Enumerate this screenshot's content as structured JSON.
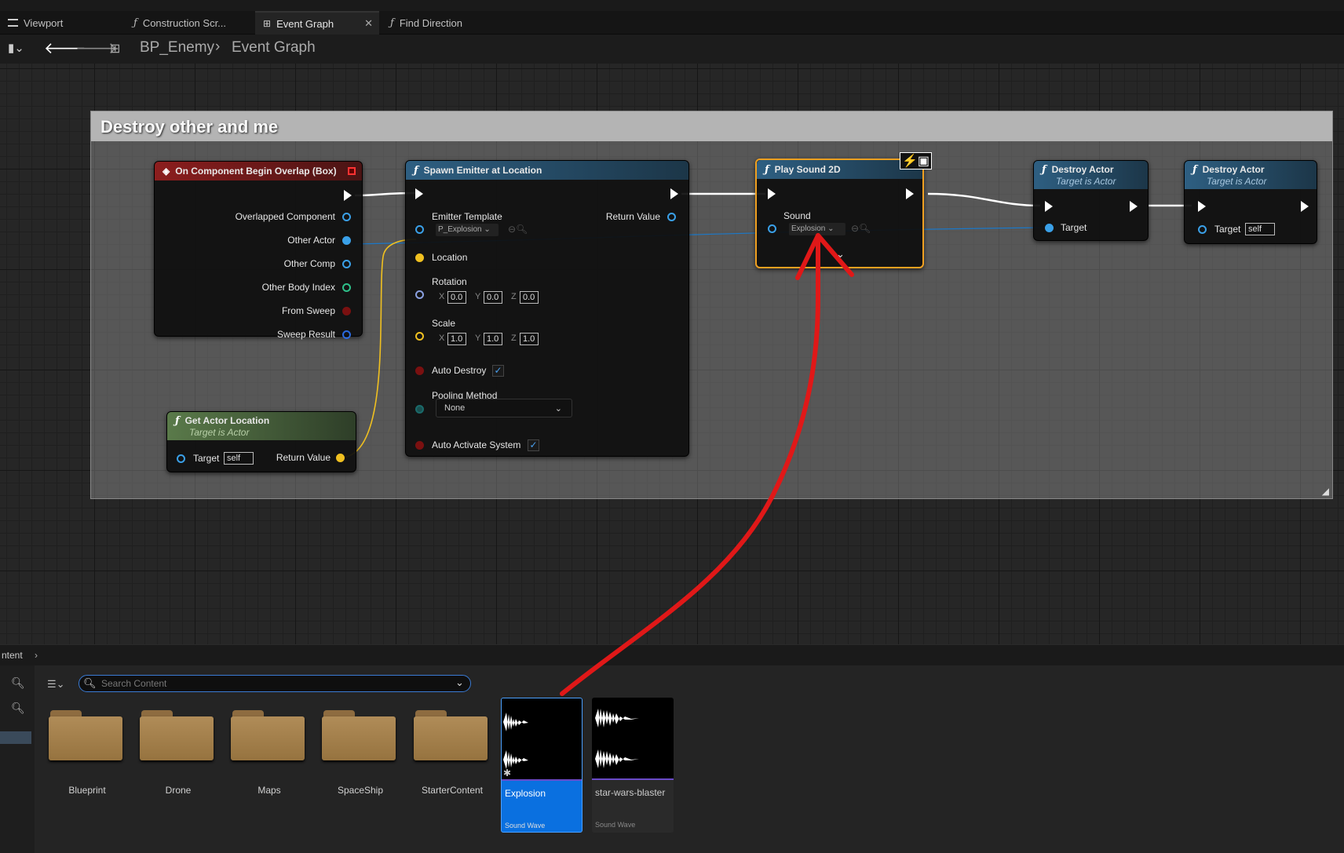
{
  "tabs": [
    {
      "label": "Viewport"
    },
    {
      "label": "Construction Scr..."
    },
    {
      "label": "Event Graph"
    },
    {
      "label": "Find Direction"
    }
  ],
  "breadcrumb": {
    "root": "BP_Enemy",
    "current": "Event Graph"
  },
  "comment": {
    "title": "Destroy other and me"
  },
  "nodes": {
    "overlap": {
      "title": "On Component Begin Overlap (Box)",
      "pins": [
        "Overlapped Component",
        "Other Actor",
        "Other Comp",
        "Other Body Index",
        "From Sweep",
        "Sweep Result"
      ]
    },
    "spawn": {
      "title": "Spawn Emitter at Location",
      "emitter_label": "Emitter Template",
      "emitter_value": "P_Explosion",
      "return_label": "Return Value",
      "location": "Location",
      "rotation": "Rotation",
      "scale": "Scale",
      "rot": {
        "x": "0.0",
        "y": "0.0",
        "z": "0.0"
      },
      "scl": {
        "x": "1.0",
        "y": "1.0",
        "z": "1.0"
      },
      "axis": {
        "x": "X",
        "y": "Y",
        "z": "Z"
      },
      "auto_destroy": "Auto Destroy",
      "pooling": "Pooling Method",
      "pooling_value": "None",
      "auto_activate": "Auto Activate System"
    },
    "getloc": {
      "title": "Get Actor Location",
      "subtitle": "Target is Actor",
      "target": "Target",
      "self": "self",
      "return_label": "Return Value"
    },
    "play": {
      "title": "Play Sound 2D",
      "sound": "Sound",
      "sound_value": "Explosion"
    },
    "destroy1": {
      "title": "Destroy Actor",
      "subtitle": "Target is Actor",
      "target": "Target"
    },
    "destroy2": {
      "title": "Destroy Actor",
      "subtitle": "Target is Actor",
      "target": "Target",
      "self": "self"
    }
  },
  "content_browser": {
    "breadcrumb": "ntent",
    "search_placeholder": "Search Content",
    "folders": [
      "Blueprint",
      "Drone",
      "Maps",
      "SpaceShip",
      "StarterContent"
    ],
    "assets": [
      {
        "name": "Explosion",
        "type": "Sound Wave"
      },
      {
        "name": "star-wars-blaster",
        "type": "Sound Wave"
      }
    ]
  },
  "colors": {
    "selection": "#f0a020",
    "annotation_arrow": "#e01818",
    "asset_selected": "#0a70e0"
  }
}
